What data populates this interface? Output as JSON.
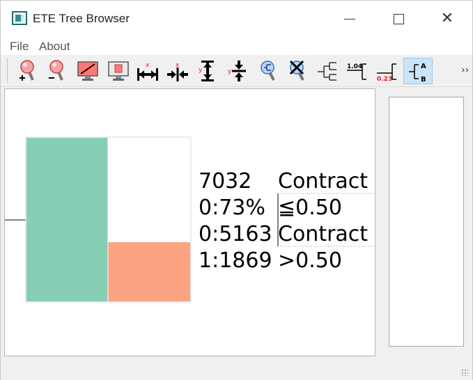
{
  "window": {
    "title": "ETE Tree Browser",
    "minimize_icon": "minimize-icon",
    "maximize_icon": "maximize-icon",
    "close_glyph": "✕"
  },
  "menu": {
    "items": [
      {
        "label": "File"
      },
      {
        "label": "About"
      }
    ]
  },
  "toolbar": {
    "buttons": [
      {
        "icon": "zoom-in-icon"
      },
      {
        "icon": "zoom-out-icon"
      },
      {
        "icon": "fit-diagonal-icon"
      },
      {
        "icon": "fit-screen-icon"
      },
      {
        "icon": "increase-x-icon"
      },
      {
        "icon": "decrease-x-icon"
      },
      {
        "icon": "increase-y-icon"
      },
      {
        "icon": "decrease-y-icon"
      },
      {
        "icon": "search-node-icon"
      },
      {
        "icon": "clear-search-icon"
      },
      {
        "icon": "tree-layout-icon"
      },
      {
        "icon": "branch-length-icon"
      },
      {
        "icon": "branch-support-icon"
      },
      {
        "icon": "leaf-names-icon"
      }
    ],
    "labels": {
      "branch_length": "1.04",
      "branch_support": "0.23",
      "leaf_a": "A",
      "leaf_b": "B",
      "increase_x": "x",
      "decrease_x": "x",
      "increase_y": "y",
      "decrease_y": "y"
    },
    "overflow_glyph": "››",
    "colors": {
      "active_bg": "#cce4f7",
      "support_red": "#e0202a"
    }
  },
  "node": {
    "samples": "7032",
    "percent": "0:73%",
    "class0": "0:5163",
    "class1": "1:1869",
    "feature_top": "Contract",
    "cond_le": "≦0.50",
    "feature_bottom": "Contract",
    "cond_gt": ">0.50",
    "bar": {
      "class0_fraction": 1.0,
      "class1_fraction": 0.362,
      "class0_color": "#86cfb5",
      "class1_color": "#fca382"
    }
  }
}
